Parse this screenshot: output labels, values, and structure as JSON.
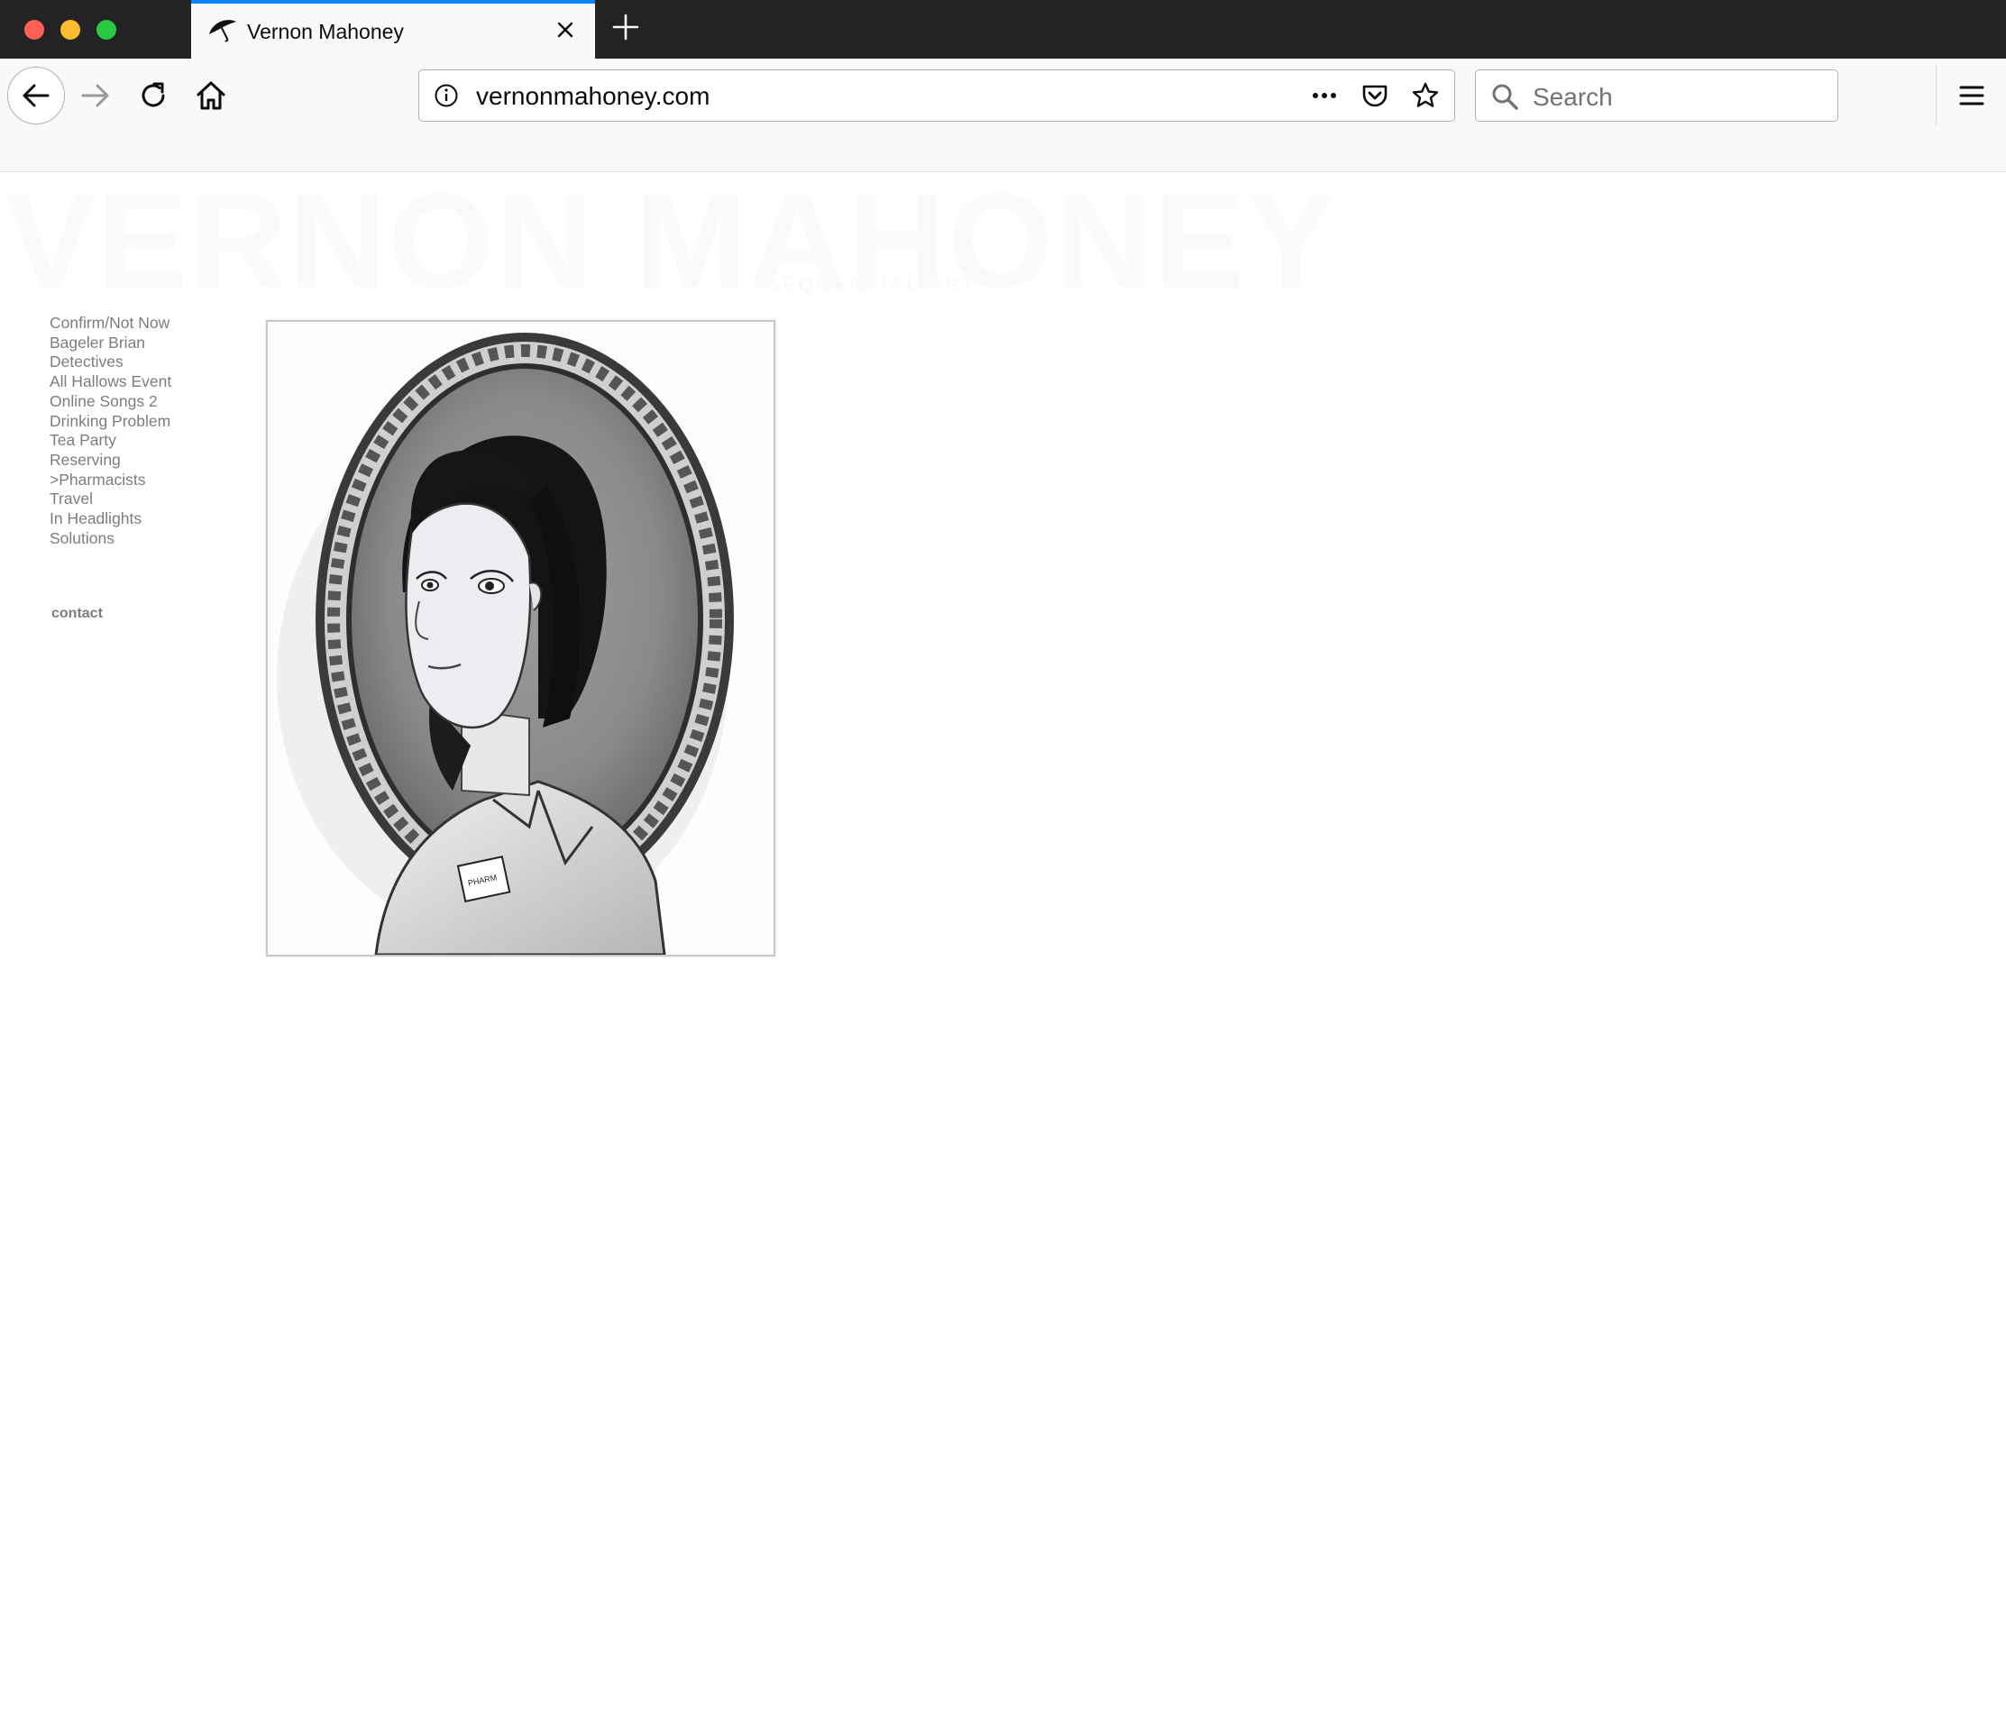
{
  "browser": {
    "tab": {
      "title": "Vernon Mahoney"
    },
    "url": "vernonmahoney.com",
    "search_placeholder": "Search"
  },
  "site": {
    "logo_text": "VERNON MAHONEY",
    "tagline": "SEQUENTIAL ART"
  },
  "sidebar": {
    "items": [
      {
        "label": "Confirm/Not Now"
      },
      {
        "label": "Bageler Brian"
      },
      {
        "label": "Detectives"
      },
      {
        "label": "All Hallows Event"
      },
      {
        "label": "Online Songs 2"
      },
      {
        "label": "Drinking Problem"
      },
      {
        "label": "Tea Party"
      },
      {
        "label": "Reserving"
      },
      {
        "label": ">Pharmacists"
      },
      {
        "label": "Travel"
      },
      {
        "label": "In Headlights"
      },
      {
        "label": "Solutions"
      }
    ],
    "contact_label": "contact"
  },
  "artwork": {
    "badge_text": "PHARM"
  },
  "colors": {
    "tab_accent": "#0a84ff",
    "nav_link": "#7d7d7d",
    "chrome_dark": "#232323"
  },
  "icons": [
    "umbrella-favicon-icon",
    "close-icon",
    "plus-icon",
    "back-arrow-icon",
    "forward-arrow-icon",
    "reload-icon",
    "home-icon",
    "info-icon",
    "more-dots-icon",
    "pocket-icon",
    "star-icon",
    "search-icon",
    "hamburger-menu-icon"
  ]
}
